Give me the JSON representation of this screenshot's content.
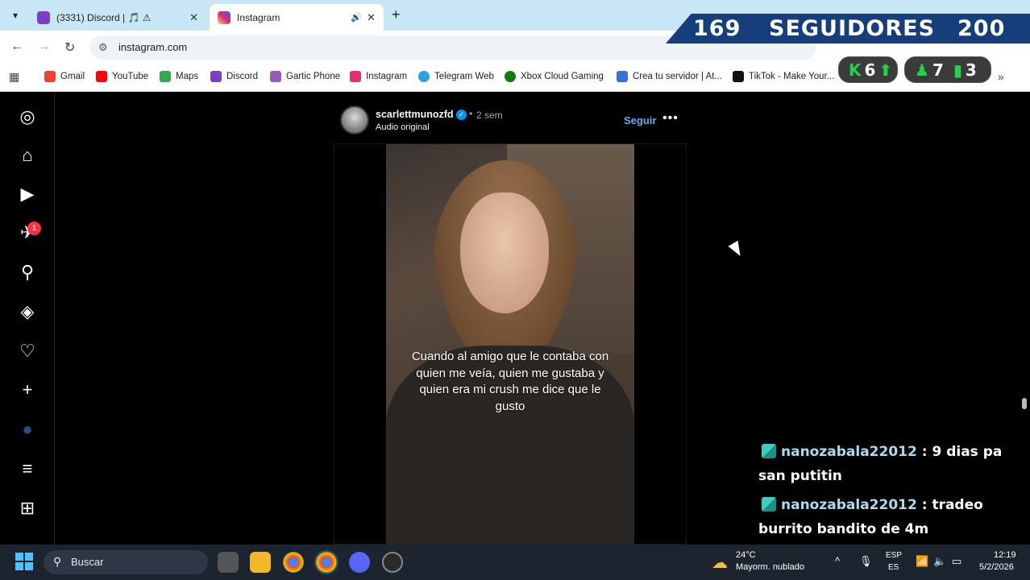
{
  "browser": {
    "tabs": [
      {
        "title": "(3331) Discord | 🎵 ⚠",
        "active": false,
        "favicon_color": "#7a3fc4"
      },
      {
        "title": "Instagram",
        "active": true,
        "favicon_color": "#e1306c"
      }
    ],
    "address": "instagram.com",
    "bookmarks": [
      {
        "label": "Gmail",
        "icon": "gmail-icon",
        "color": "#ea4335"
      },
      {
        "label": "YouTube",
        "icon": "youtube-icon",
        "color": "#ff0000"
      },
      {
        "label": "Maps",
        "icon": "maps-icon",
        "color": "#34a853"
      },
      {
        "label": "Discord",
        "icon": "discord-icon",
        "color": "#7a3fc4"
      },
      {
        "label": "Gartic Phone",
        "icon": "gartic-icon",
        "color": "#9b59b6"
      },
      {
        "label": "Instagram",
        "icon": "instagram-icon",
        "color": "#e1306c"
      },
      {
        "label": "Telegram Web",
        "icon": "telegram-icon",
        "color": "#2aa3e0"
      },
      {
        "label": "Xbox Cloud Gaming",
        "icon": "xbox-icon",
        "color": "#107c10"
      },
      {
        "label": "Crea tu servidor | At...",
        "icon": "server-icon",
        "color": "#3a6fd8"
      },
      {
        "label": "TikTok - Make Your...",
        "icon": "tiktok-icon",
        "color": "#111111"
      }
    ]
  },
  "overlay": {
    "followers_current": "169",
    "followers_label": "SEGUIDORES",
    "followers_goal": "200",
    "stat_left": "6",
    "stat_mid": "7",
    "stat_right": "3"
  },
  "post": {
    "username": "scarlettmunozfd",
    "time": "2 sem",
    "audio": "Audio original",
    "follow": "Seguir",
    "caption": "Cuando al amigo que le contaba con quien me veía, quien me gustaba y quien era mi crush me dice que le gusto"
  },
  "sidebar": {
    "notification_count": "1"
  },
  "chat": [
    {
      "user": "nanozabala22012",
      "message": ": 9 dias pa san putitin"
    },
    {
      "user": "nanozabala22012",
      "message": ": tradeo burrito bandito de 4m"
    }
  ],
  "taskbar": {
    "search_placeholder": "Buscar",
    "temperature": "24°C",
    "weather": "Mayorm. nublado",
    "lang_top": "ESP",
    "lang_bottom": "ES",
    "time": "12:19",
    "date": "5/2/2026"
  }
}
